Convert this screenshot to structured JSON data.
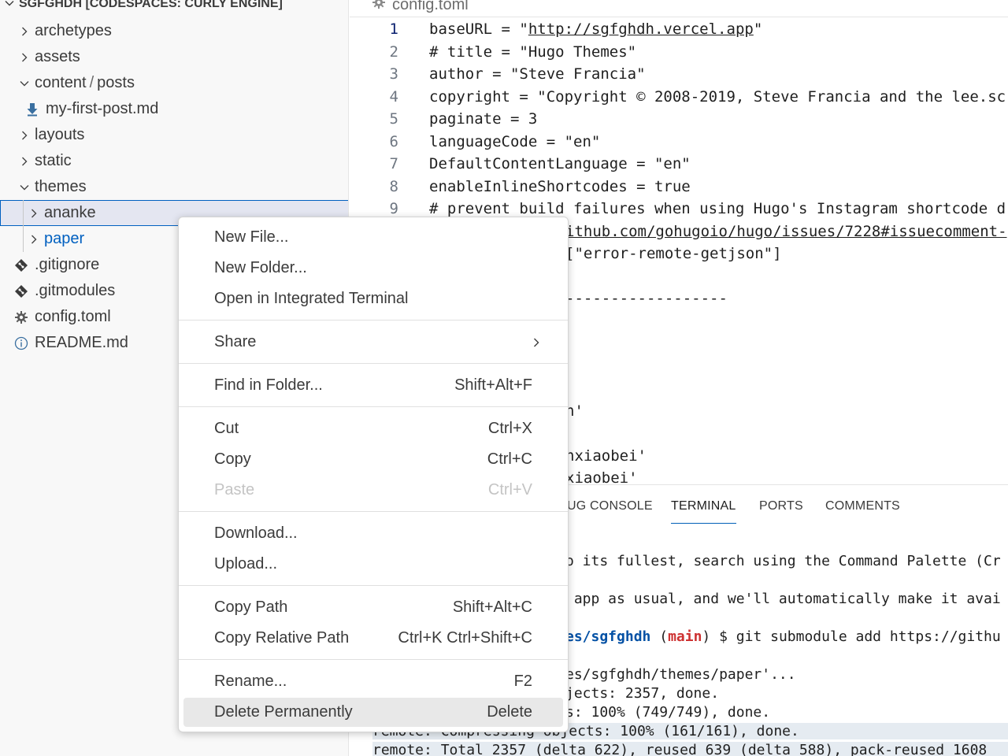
{
  "explorer": {
    "section_title": "SGFGHDH [CODESPACES: CURLY ENGINE]",
    "items": [
      {
        "label": "archetypes",
        "kind": "folder"
      },
      {
        "label": "assets",
        "kind": "folder"
      },
      {
        "label": "content",
        "label2": "posts",
        "sep": "/",
        "kind": "folder-open"
      },
      {
        "label": "my-first-post.md",
        "kind": "markdown-file"
      },
      {
        "label": "layouts",
        "kind": "folder"
      },
      {
        "label": "static",
        "kind": "folder"
      },
      {
        "label": "themes",
        "kind": "folder-open"
      },
      {
        "label": "ananke",
        "kind": "folder",
        "selected": true
      },
      {
        "label": "paper",
        "kind": "folder"
      },
      {
        "label": ".gitignore",
        "kind": "git-file"
      },
      {
        "label": ".gitmodules",
        "kind": "git-file"
      },
      {
        "label": "config.toml",
        "kind": "settings-file"
      },
      {
        "label": "README.md",
        "kind": "info-file"
      }
    ]
  },
  "editor": {
    "tab_title": "config.toml",
    "lines": [
      {
        "n": "1",
        "text_before": "baseURL = \"",
        "link": "http://sgfghdh.vercel.app",
        "text_after": "\""
      },
      {
        "n": "2",
        "text": "# title = \"Hugo Themes\""
      },
      {
        "n": "3",
        "text": "author = \"Steve Francia\""
      },
      {
        "n": "4",
        "text": "copyright = \"Copyright © 2008-2019, Steve Francia and the lee.sc"
      },
      {
        "n": "5",
        "text": "paginate = 3"
      },
      {
        "n": "6",
        "text": "languageCode = \"en\""
      },
      {
        "n": "7",
        "text": "DefaultContentLanguage = \"en\""
      },
      {
        "n": "8",
        "text": "enableInlineShortcodes = true"
      },
      {
        "n": "9",
        "text": "# prevent build failures when using Hugo's Instagram shortcode d"
      }
    ],
    "partial_lines": [
      {
        "text_link": "ithub.com/gohugoio/hugo/issues/7228#issuecomment-"
      },
      {
        "text": "[\"error-remote-getjson\"]"
      },
      {
        "text": ""
      },
      {
        "text": "------------------"
      },
      {
        "text": ""
      },
      {
        "text": ""
      },
      {
        "text": ""
      },
      {
        "text": ""
      },
      {
        "text": "n'"
      },
      {
        "text": ""
      },
      {
        "text": "nxiaobei'"
      },
      {
        "text": "xiaobei'"
      }
    ]
  },
  "panel": {
    "tabs": [
      {
        "label": "UG CONSOLE",
        "active": false
      },
      {
        "label": "TERMINAL",
        "active": true
      },
      {
        "label": "PORTS",
        "active": false
      },
      {
        "label": "COMMENTS",
        "active": false
      }
    ],
    "terminal": {
      "line1": "o its fullest, search using the Command Palette (Cr",
      "line2": " app as usual, and we'll automatically make it avai",
      "line3_path": "es/sgfghdh",
      "line3_branch": "main",
      "line3_open": " (",
      "line3_close": ")",
      "line3_cmd": " $ git submodule add https://githu",
      "line4": "es/sgfghdh/themes/paper'...",
      "line5": "jects: 2357, done.",
      "line6": "s: 100% (749/749), done.",
      "line7": "remote: Compressing objects: 100% (161/161), done.",
      "line8": "remote: Total 2357 (delta 622), reused 639 (delta 588), pack-reused 1608"
    }
  },
  "context_menu": {
    "groups": [
      [
        {
          "label": "New File...",
          "shortcut": ""
        },
        {
          "label": "New Folder...",
          "shortcut": ""
        },
        {
          "label": "Open in Integrated Terminal",
          "shortcut": ""
        }
      ],
      [
        {
          "label": "Share",
          "shortcut": "",
          "submenu": true
        }
      ],
      [
        {
          "label": "Find in Folder...",
          "shortcut": "Shift+Alt+F"
        }
      ],
      [
        {
          "label": "Cut",
          "shortcut": "Ctrl+X"
        },
        {
          "label": "Copy",
          "shortcut": "Ctrl+C"
        },
        {
          "label": "Paste",
          "shortcut": "Ctrl+V",
          "disabled": true
        }
      ],
      [
        {
          "label": "Download...",
          "shortcut": ""
        },
        {
          "label": "Upload...",
          "shortcut": ""
        }
      ],
      [
        {
          "label": "Copy Path",
          "shortcut": "Shift+Alt+C"
        },
        {
          "label": "Copy Relative Path",
          "shortcut": "Ctrl+K Ctrl+Shift+C"
        }
      ],
      [
        {
          "label": "Rename...",
          "shortcut": "F2"
        },
        {
          "label": "Delete Permanently",
          "shortcut": "Delete",
          "hover": true
        }
      ]
    ]
  },
  "colors": {
    "accent": "#005fb8",
    "selection_outline": "#0060c0",
    "sidebar_bg": "#f8f8f8",
    "terminal_path": "#0451a5",
    "terminal_branch": "#cd3131",
    "markdown_icon": "#3a6fa0"
  }
}
